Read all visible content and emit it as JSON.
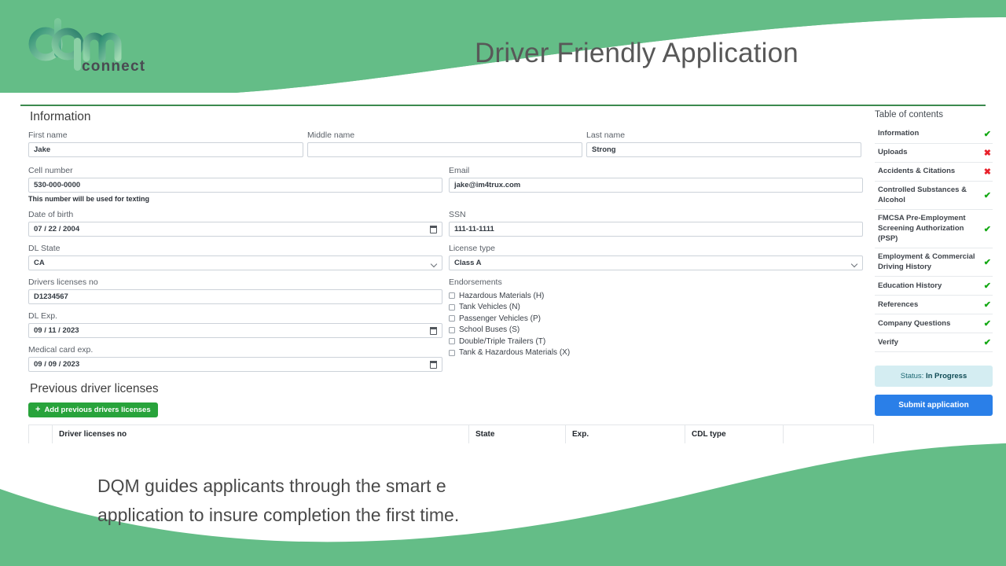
{
  "theme": {
    "green": "#64bd87",
    "green_rule": "#3c8a4f",
    "blue": "#2a7fe8",
    "add_green": "#28a33b",
    "status_bg": "#d4edf2",
    "check_green": "#13a813",
    "cross_red": "#e8202a"
  },
  "header": {
    "logo_text": "connect",
    "logo_mark": "dqm",
    "title": "Driver Friendly Application"
  },
  "form": {
    "section_title": "Information",
    "fields": {
      "first_name": {
        "label": "First name",
        "value": "Jake"
      },
      "middle_name": {
        "label": "Middle name",
        "value": ""
      },
      "last_name": {
        "label": "Last name",
        "value": "Strong"
      },
      "cell_number": {
        "label": "Cell number",
        "value": "530-000-0000",
        "helper": "This number will be used for texting"
      },
      "email": {
        "label": "Email",
        "value": "jake@im4trux.com"
      },
      "date_of_birth": {
        "label": "Date of birth",
        "value": "07 / 22 / 2004"
      },
      "ssn": {
        "label": "SSN",
        "value": "111-11-1111"
      },
      "dl_state": {
        "label": "DL State",
        "value": "CA"
      },
      "license_type": {
        "label": "License type",
        "value": "Class A"
      },
      "drivers_license_no": {
        "label": "Drivers licenses no",
        "value": "D1234567"
      },
      "dl_exp": {
        "label": "DL Exp.",
        "value": "09 / 11 / 2023"
      },
      "medical_card_exp": {
        "label": "Medical card exp.",
        "value": "09 / 09 / 2023"
      }
    },
    "endorsements": {
      "label": "Endorsements",
      "options": [
        {
          "label": "Hazardous Materials (H)",
          "checked": false
        },
        {
          "label": "Tank Vehicles (N)",
          "checked": false
        },
        {
          "label": "Passenger Vehicles (P)",
          "checked": false
        },
        {
          "label": "School Buses (S)",
          "checked": false
        },
        {
          "label": "Double/Triple Trailers (T)",
          "checked": false
        },
        {
          "label": "Tank & Hazardous Materials (X)",
          "checked": false
        }
      ]
    },
    "previous_licenses": {
      "heading": "Previous driver licenses",
      "add_button": "Add previous drivers licenses",
      "add_icon": "plus-icon",
      "columns": [
        "",
        "Driver licenses no",
        "State",
        "Exp.",
        "CDL type",
        ""
      ],
      "rows": []
    }
  },
  "toc": {
    "title": "Table of contents",
    "items": [
      {
        "label": "Information",
        "status": "ok",
        "mark": "✔"
      },
      {
        "label": "Uploads",
        "status": "no",
        "mark": "✖"
      },
      {
        "label": "Accidents & Citations",
        "status": "no",
        "mark": "✖"
      },
      {
        "label": "Controlled Substances & Alcohol",
        "status": "ok",
        "mark": "✔"
      },
      {
        "label": "FMCSA Pre-Employment Screening Authorization (PSP)",
        "status": "ok",
        "mark": "✔"
      },
      {
        "label": "Employment & Commercial Driving History",
        "status": "ok",
        "mark": "✔"
      },
      {
        "label": "Education History",
        "status": "ok",
        "mark": "✔"
      },
      {
        "label": "References",
        "status": "ok",
        "mark": "✔"
      },
      {
        "label": "Company Questions",
        "status": "ok",
        "mark": "✔"
      },
      {
        "label": "Verify",
        "status": "ok",
        "mark": "✔"
      }
    ],
    "status_prefix": "Status: ",
    "status_value": "In Progress",
    "submit_label": "Submit application"
  },
  "caption": {
    "line1": "DQM guides applicants through the smart e",
    "line2": "application to insure completion the first time."
  }
}
